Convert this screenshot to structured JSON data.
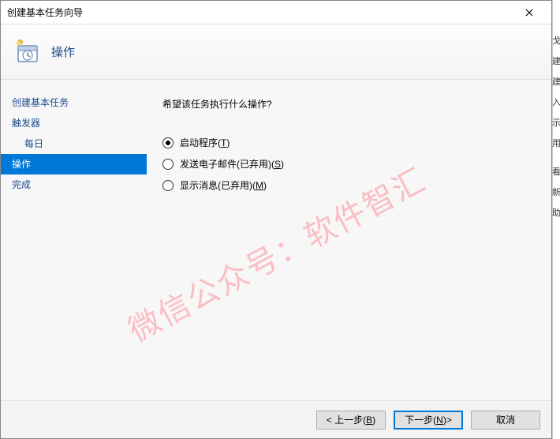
{
  "window": {
    "title": "创建基本任务向导"
  },
  "header": {
    "step_title": "操作"
  },
  "nav": {
    "items": [
      {
        "label": "创建基本任务",
        "sub": false,
        "selected": false
      },
      {
        "label": "触发器",
        "sub": false,
        "selected": false
      },
      {
        "label": "每日",
        "sub": true,
        "selected": false
      },
      {
        "label": "操作",
        "sub": false,
        "selected": true
      },
      {
        "label": "完成",
        "sub": false,
        "selected": false
      }
    ]
  },
  "content": {
    "prompt": "希望该任务执行什么操作?",
    "options": [
      {
        "label": "启动程序",
        "accel": "T",
        "checked": true
      },
      {
        "label": "发送电子邮件(已弃用)",
        "accel": "S",
        "checked": false
      },
      {
        "label": "显示消息(已弃用)",
        "accel": "M",
        "checked": false
      }
    ]
  },
  "footer": {
    "back": {
      "label": "< 上一步",
      "accel": "B"
    },
    "next": {
      "label": "下一步",
      "accel": "N",
      "suffix": " >"
    },
    "cancel": {
      "label": "取消"
    }
  },
  "watermark": "微信公众号：软件智汇",
  "right_fragments": [
    "戈",
    "建",
    "建",
    "入",
    "示",
    "用",
    "看",
    "新",
    "助"
  ]
}
